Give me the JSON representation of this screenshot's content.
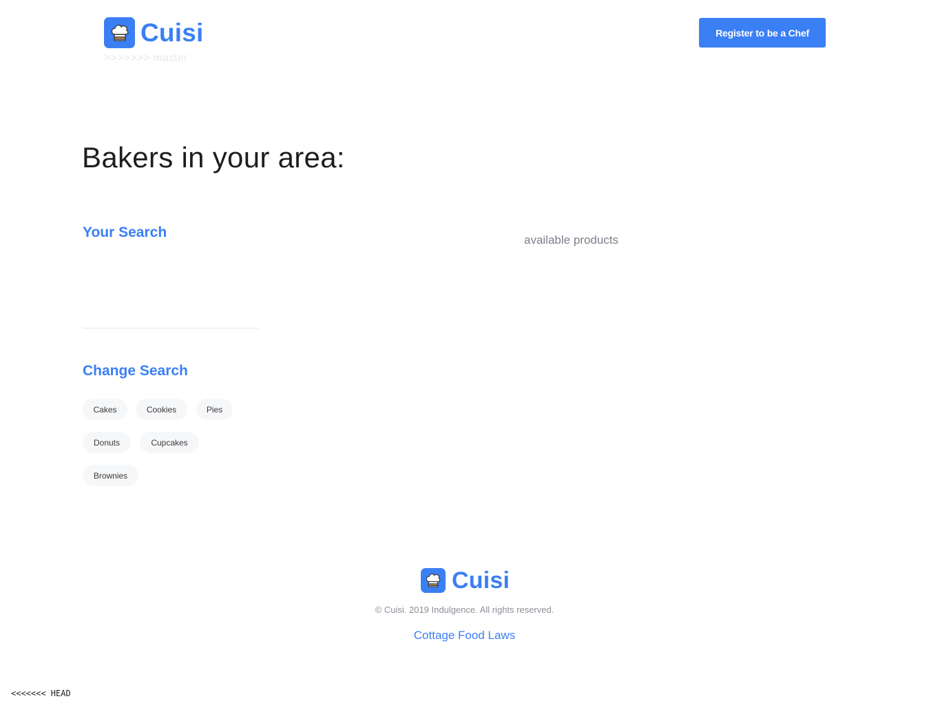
{
  "header": {
    "logo_text": "Cuisi",
    "merge_marker": ">>>>>>> master",
    "register_button": "Register to be a Chef"
  },
  "main": {
    "title": "Bakers in your area:",
    "your_search_heading": "Your Search",
    "available_products": "available products",
    "change_search_heading": "Change Search",
    "categories": [
      "Cakes",
      "Cookies",
      "Pies",
      "Donuts",
      "Cupcakes",
      "Brownies"
    ]
  },
  "footer": {
    "logo_text": "Cuisi",
    "copyright": "© Cuisi. 2019 Indulgence. All rights reserved.",
    "link": "Cottage Food Laws"
  },
  "merge_marker_head": "<<<<<<< HEAD",
  "colors": {
    "brand": "#3b7ff5",
    "chip_bg": "#f6f7f9",
    "muted_text": "#7b7f8a"
  },
  "icons": {
    "logo": "chef-hat-icon"
  }
}
